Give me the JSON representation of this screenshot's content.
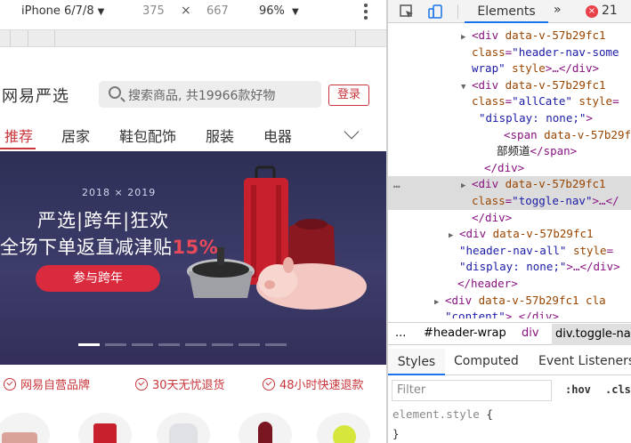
{
  "device_toolbar": {
    "device": "iPhone 6/7/8",
    "device_arrow": "▼",
    "width": "375",
    "times": "×",
    "height": "667",
    "zoom": "96%",
    "zoom_arrow": "▼"
  },
  "page": {
    "logo": "网易严选",
    "search_placeholder": "搜索商品, 共19966款好物",
    "login": "登录",
    "tabs": [
      "推荐",
      "居家",
      "鞋包配饰",
      "服装",
      "电器"
    ],
    "banner": {
      "tag": "2018 × 2019",
      "line1": "严选|跨年|狂欢",
      "line2": "全场下单返直减津贴",
      "percent": "15%",
      "cta": "参与跨年"
    },
    "promos": [
      "网易自营品牌",
      "30天无忧退货",
      "48小时快速退款"
    ]
  },
  "devtools": {
    "tabs": {
      "elements": "Elements",
      "more": "»",
      "error_count": "21",
      "error_glyph": "×"
    },
    "tree_lines": [
      {
        "tw": "▶",
        "parts": [
          [
            "tag",
            "<div "
          ],
          [
            "an",
            "data-v-57b29fc1"
          ]
        ]
      },
      {
        "parts": [
          [
            "an",
            "class"
          ],
          [
            "tag",
            "="
          ],
          [
            "av",
            "\"header-nav-some"
          ]
        ]
      },
      {
        "parts": [
          [
            "av",
            "wrap\""
          ],
          [
            "an",
            " style"
          ],
          [
            "tag",
            ">…</div>"
          ]
        ]
      },
      {
        "tw": "▼",
        "parts": [
          [
            "tag",
            "<div "
          ],
          [
            "an",
            "data-v-57b29fc1"
          ]
        ]
      },
      {
        "parts": [
          [
            "an",
            "class"
          ],
          [
            "tag",
            "="
          ],
          [
            "av",
            "\"allCate\""
          ],
          [
            "an",
            " style"
          ],
          [
            "tag",
            "="
          ]
        ]
      },
      {
        "parts": [
          [
            "av",
            "\"display: none;\""
          ],
          [
            "tag",
            ">"
          ]
        ]
      },
      {
        "parts": [
          [
            "tag",
            "<span "
          ],
          [
            "an",
            "data-v-57b29f"
          ]
        ]
      },
      {
        "parts": [
          [
            "tx",
            "部频道"
          ],
          [
            "tag",
            "</span>"
          ]
        ]
      },
      {
        "parts": [
          [
            "tag",
            "</div>"
          ]
        ]
      },
      {
        "tw": "▶",
        "parts": [
          [
            "tag",
            "<div "
          ],
          [
            "an",
            "data-v-57b29fc1"
          ]
        ]
      },
      {
        "parts": [
          [
            "an",
            "class"
          ],
          [
            "tag",
            "="
          ],
          [
            "av",
            "\"toggle-nav\""
          ],
          [
            "tag",
            ">…</"
          ]
        ]
      },
      {
        "parts": [
          [
            "tag",
            "</div>"
          ]
        ]
      },
      {
        "tw": "▶",
        "parts": [
          [
            "tag",
            "<div "
          ],
          [
            "an",
            "data-v-57b29fc1"
          ]
        ]
      },
      {
        "parts": [
          [
            "av",
            "\"header-nav-all\""
          ],
          [
            "an",
            " style"
          ],
          [
            "tag",
            "="
          ]
        ]
      },
      {
        "parts": [
          [
            "av",
            "\"display: none;\""
          ],
          [
            "tag",
            ">…</div>"
          ]
        ]
      },
      {
        "parts": [
          [
            "tag",
            "</header>"
          ]
        ]
      },
      {
        "tw": "▶",
        "parts": [
          [
            "tag",
            "<div "
          ],
          [
            "an",
            "data-v-57b29fc1"
          ],
          [
            "an",
            " cla"
          ]
        ]
      },
      {
        "parts": [
          [
            "av",
            "\"content\""
          ],
          [
            "tag",
            "> </div>"
          ]
        ]
      }
    ],
    "row_dots": "…",
    "breadcrumbs": {
      "dots": "...",
      "header": "#header-wrap",
      "div": "div",
      "selected": "div.toggle-na"
    },
    "subtabs": {
      "styles": "Styles",
      "computed": "Computed",
      "listeners": "Event Listeners"
    },
    "filter": "Filter",
    "hov": ":hov",
    "cls": ".cls",
    "element_style": "element.style",
    "open_brace": "{",
    "close_brace": "}"
  }
}
